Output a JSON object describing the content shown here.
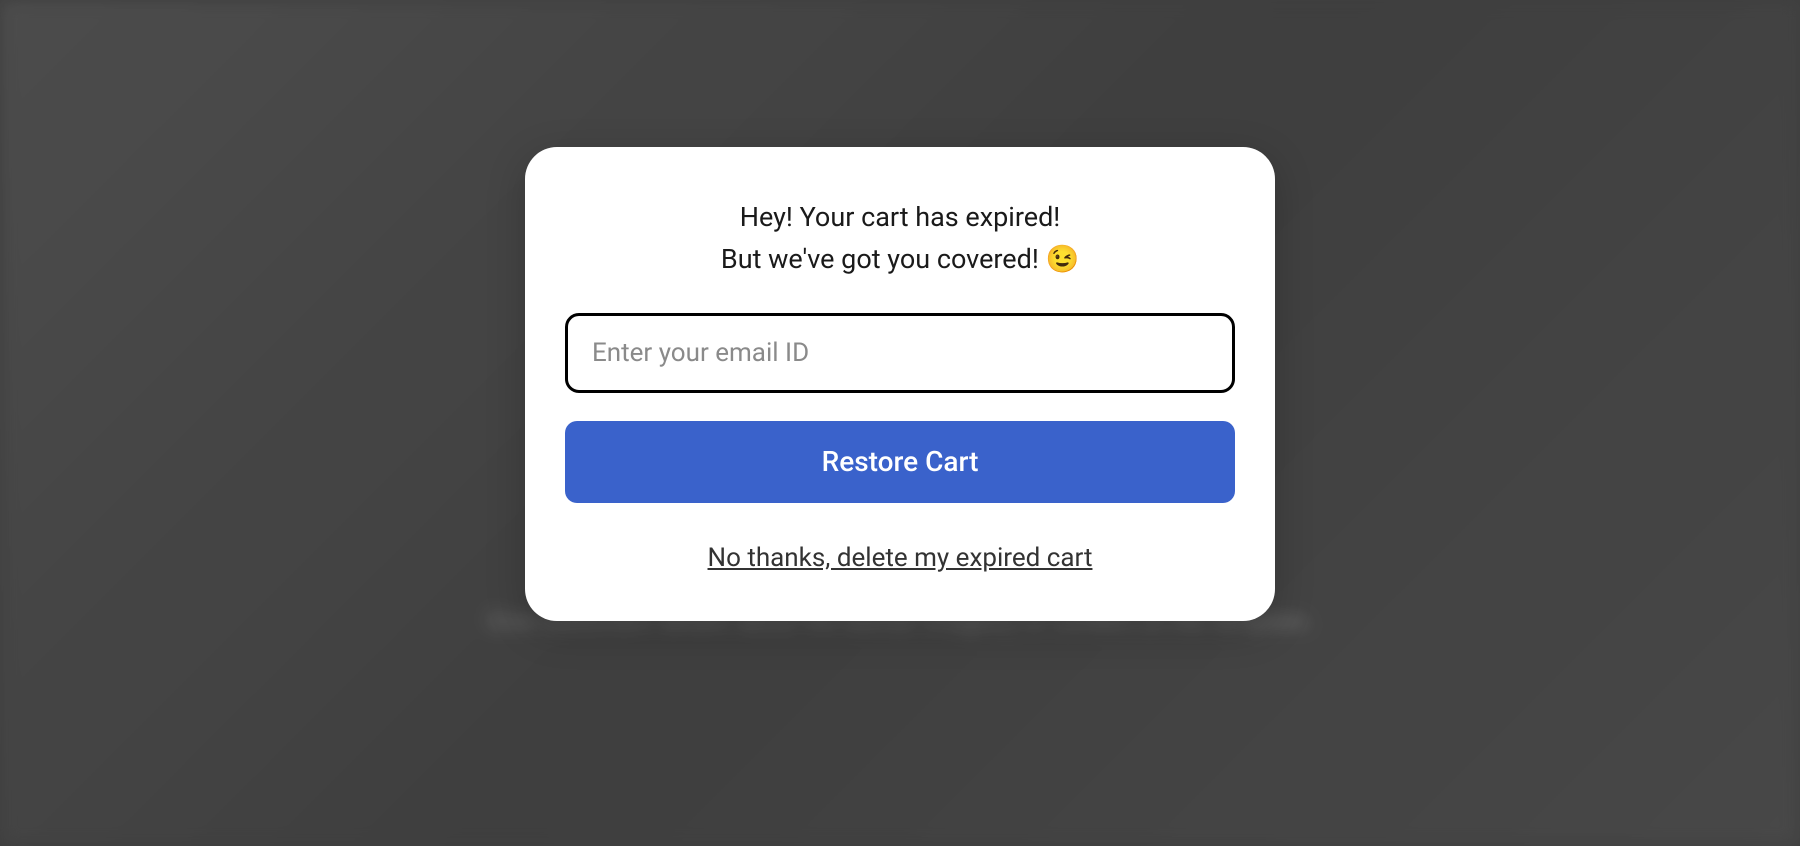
{
  "backdrop": {
    "title": "Image Banner",
    "subtitle": "Give customers details about the banner image(s) or content on the template."
  },
  "modal": {
    "message_line1": "Hey! Your cart has expired!",
    "message_line2": "But we've got you covered! 😉",
    "email_placeholder": "Enter your email ID",
    "email_value": "",
    "restore_button_label": "Restore Cart",
    "decline_link_label": "No thanks, delete my expired cart"
  },
  "colors": {
    "primary_button": "#3a62cb",
    "modal_bg": "#ffffff",
    "text": "#1a1a1a"
  }
}
